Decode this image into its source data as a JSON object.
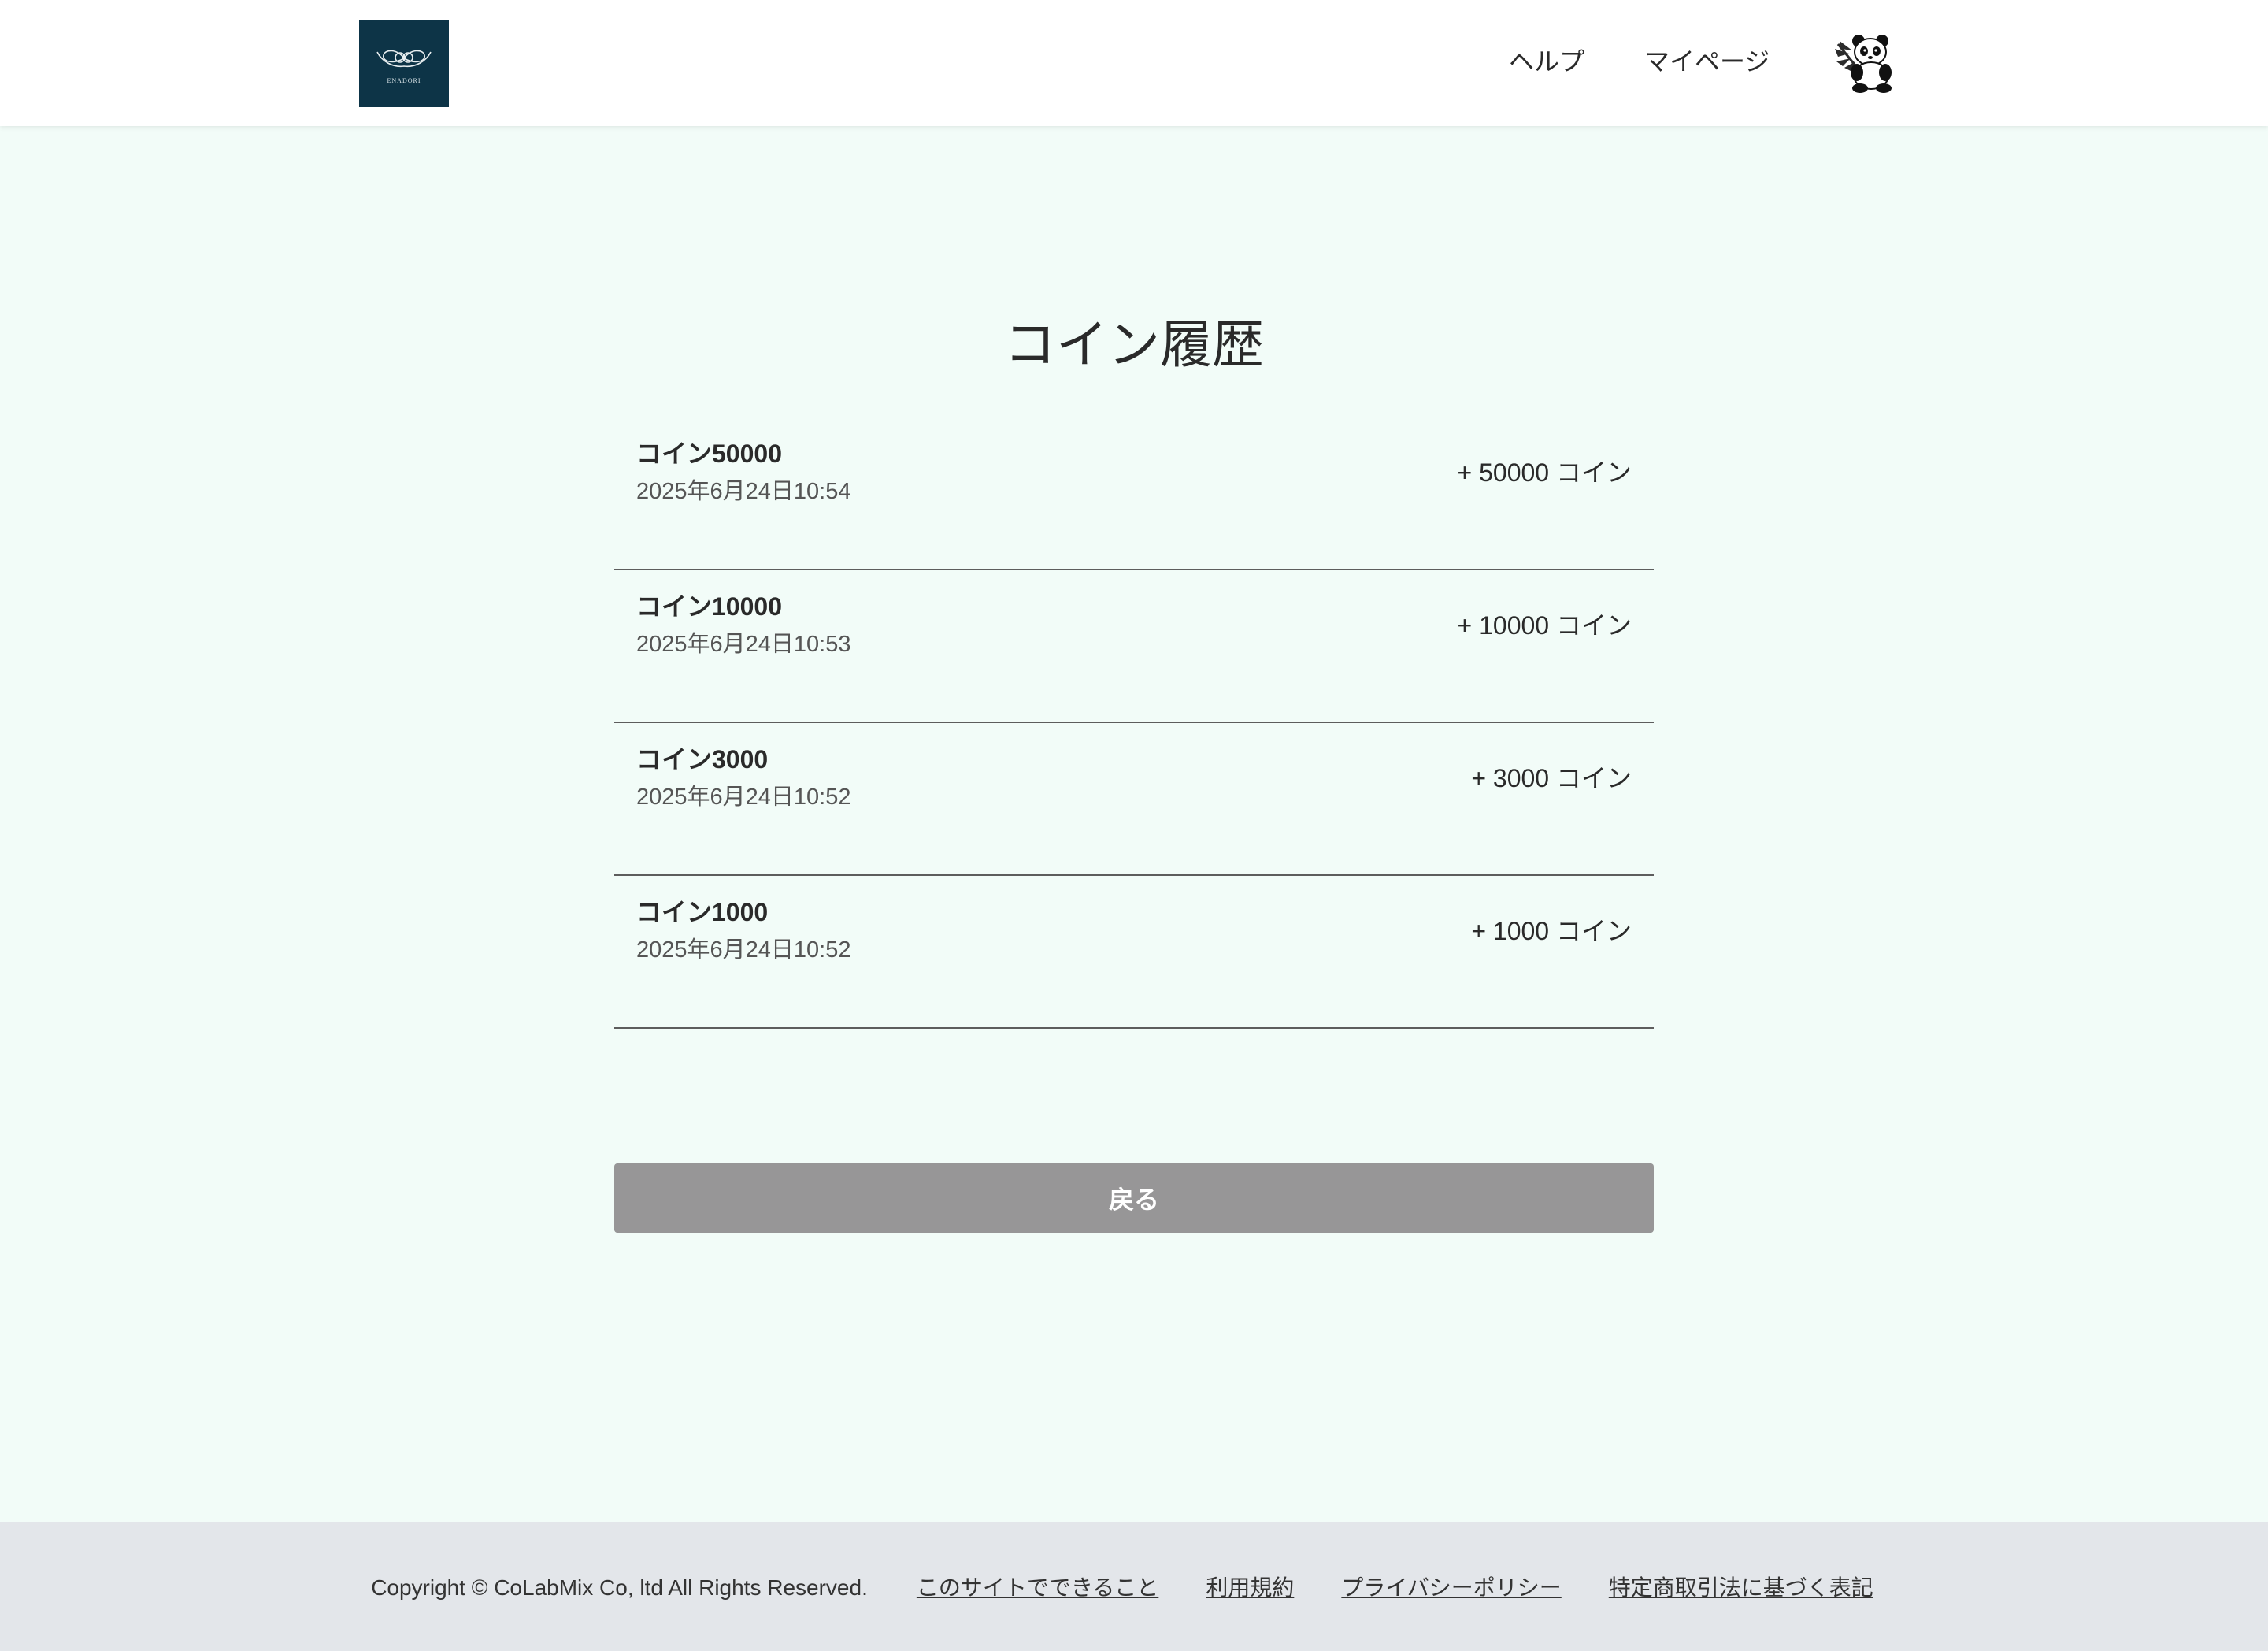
{
  "header": {
    "logo_text": "ENADORI",
    "nav": {
      "help": "ヘルプ",
      "mypage": "マイページ"
    },
    "avatar_icon": "panda-icon",
    "logo_bg": "#0d3447"
  },
  "main": {
    "title": "コイン履歴",
    "history": [
      {
        "name": "コイン50000",
        "date": "2025年6月24日10:54",
        "amount": "+ 50000 コイン"
      },
      {
        "name": "コイン10000",
        "date": "2025年6月24日10:53",
        "amount": "+ 10000 コイン"
      },
      {
        "name": "コイン3000",
        "date": "2025年6月24日10:52",
        "amount": "+ 3000 コイン"
      },
      {
        "name": "コイン1000",
        "date": "2025年6月24日10:52",
        "amount": "+ 1000 コイン"
      }
    ],
    "back_label": "戻る"
  },
  "footer": {
    "copyright": "Copyright © CoLabMix Co, ltd All Rights Reserved.",
    "links": [
      "このサイトでできること",
      "利用規約",
      "プライバシーポリシー",
      "特定商取引法に基づく表記"
    ]
  },
  "colors": {
    "page_bg": "#f2fcf8",
    "header_bg": "#ffffff",
    "footer_bg": "#e3e6ea",
    "button_bg": "#979697"
  }
}
